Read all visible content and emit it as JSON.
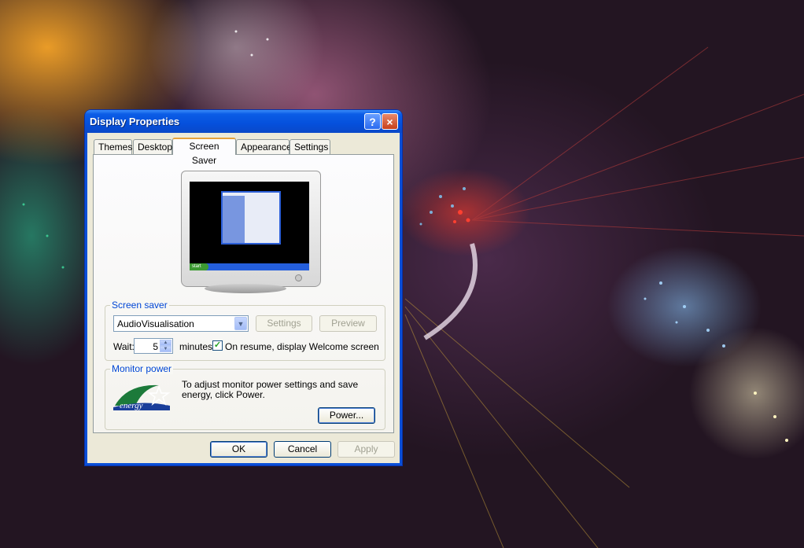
{
  "window": {
    "title": "Display Properties",
    "help_icon": "?",
    "close_icon": "×"
  },
  "tabs": [
    {
      "label": "Themes"
    },
    {
      "label": "Desktop"
    },
    {
      "label": "Screen Saver",
      "active": true
    },
    {
      "label": "Appearance"
    },
    {
      "label": "Settings"
    }
  ],
  "preview": {
    "start_label": "start"
  },
  "screen_saver": {
    "legend": "Screen saver",
    "selected": "AudioVisualisation",
    "settings_label": "Settings",
    "preview_label": "Preview",
    "wait_label": "Wait:",
    "wait_value": "5",
    "minutes_label": "minutes",
    "resume_label": "On resume, display Welcome screen",
    "resume_checked": true
  },
  "monitor_power": {
    "legend": "Monitor power",
    "description": "To adjust monitor power settings and save energy, click Power.",
    "power_label": "Power...",
    "logo_text": "energy"
  },
  "footer": {
    "ok_label": "OK",
    "cancel_label": "Cancel",
    "apply_label": "Apply"
  },
  "colors": {
    "title_blue": "#0a4fd8",
    "legend_blue": "#0046d5",
    "dialog_bg": "#ece9d8"
  }
}
